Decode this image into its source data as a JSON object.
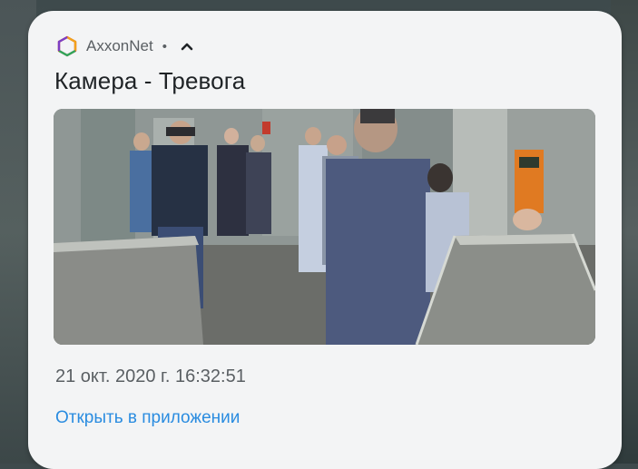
{
  "notification": {
    "app_name": "AxxonNet",
    "separator": "•",
    "title": "Камера - Тревога",
    "timestamp": "21 окт. 2020 г. 16:32:51",
    "action_label": "Открыть в приложении",
    "icons": {
      "app": "axxonnet-hexagon-icon",
      "collapse": "chevron-up-icon"
    },
    "colors": {
      "card_background": "#f3f4f5",
      "title": "#1f2326",
      "secondary_text": "#5a5f63",
      "action_link": "#2a8ce0"
    }
  }
}
